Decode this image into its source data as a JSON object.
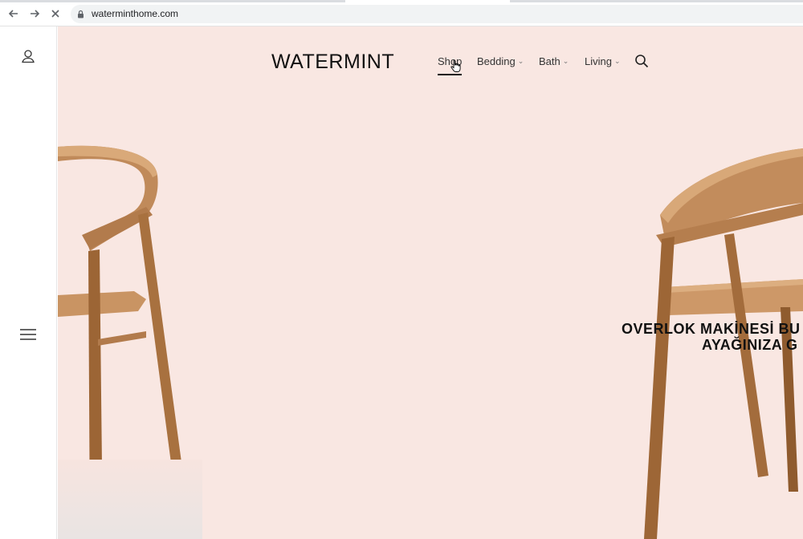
{
  "browser": {
    "url": "waterminthome.com"
  },
  "site": {
    "logo": "WATERMINT",
    "nav": [
      {
        "label": "Shop",
        "active": true,
        "dropdown": false
      },
      {
        "label": "Bedding",
        "active": false,
        "dropdown": true
      },
      {
        "label": "Bath",
        "active": false,
        "dropdown": true
      },
      {
        "label": "Living",
        "active": false,
        "dropdown": true
      }
    ],
    "hero": {
      "headline_line1": "OVERLOK MAKİNESİ BU",
      "headline_line2": "AYAĞINIZA G",
      "background": "#f9e7e2"
    }
  },
  "icons": {
    "back": "arrow-left-icon",
    "forward": "arrow-right-icon",
    "stop": "close-icon",
    "lock": "lock-icon",
    "user": "user-icon",
    "menu": "hamburger-menu-icon",
    "search": "search-icon",
    "cursor": "hand-pointer-icon"
  }
}
